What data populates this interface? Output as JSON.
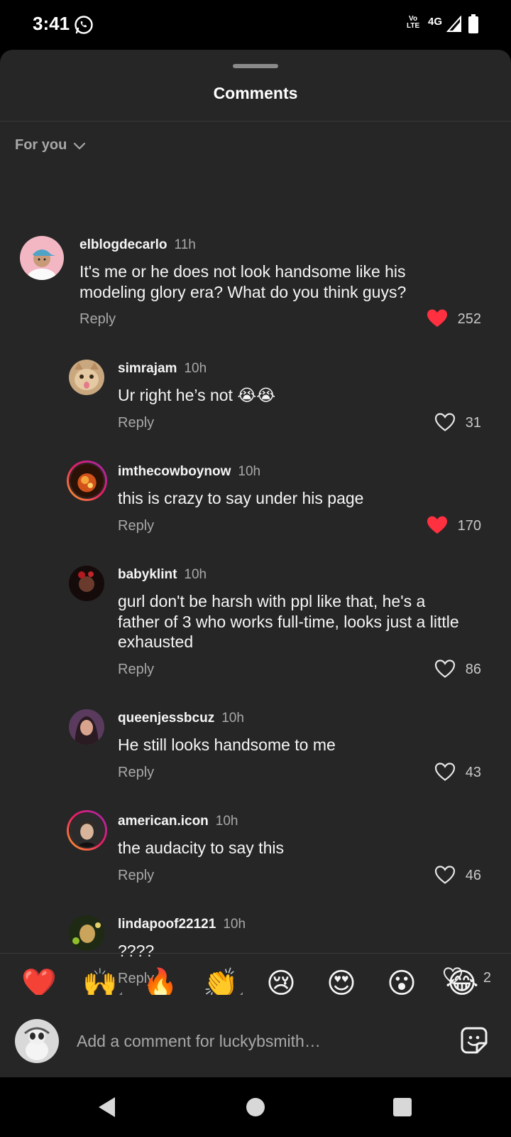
{
  "status_bar": {
    "time": "3:41",
    "network": "4G",
    "volte_line1": "Vo",
    "volte_line2": "LTE"
  },
  "sheet": {
    "title": "Comments",
    "sort_label": "For you"
  },
  "comments": [
    {
      "username": "elblogdecarlo",
      "time": "11h",
      "text": "It's me or he does not look handsome like his modeling glory era? What do you think guys?",
      "reply": "Reply",
      "likes": "252",
      "liked": true,
      "avatar_icon": "bitmoji-avatar"
    },
    {
      "username": "simrajam",
      "time": "10h",
      "text": "Ur right he’s not 😭😭",
      "reply": "Reply",
      "likes": "31",
      "liked": false,
      "avatar_icon": "cat-avatar"
    },
    {
      "username": "imthecowboynow",
      "time": "10h",
      "text": "this is  crazy to say under his page",
      "reply": "Reply",
      "likes": "170",
      "liked": true,
      "avatar_icon": "photo-avatar"
    },
    {
      "username": "babyklint",
      "time": "10h",
      "text": "gurl don't be harsh with ppl like that, he's a father of 3 who works full-time, looks just a little exhausted",
      "reply": "Reply",
      "likes": "86",
      "liked": false,
      "avatar_icon": "photo-avatar"
    },
    {
      "username": "queenjessbcuz",
      "time": "10h",
      "text": "He still looks handsome to me",
      "reply": "Reply",
      "likes": "43",
      "liked": false,
      "avatar_icon": "photo-avatar"
    },
    {
      "username": "american.icon",
      "time": "10h",
      "text": "the audacity to say this",
      "reply": "Reply",
      "likes": "46",
      "liked": false,
      "avatar_icon": "photo-avatar"
    },
    {
      "username": "lindapoof22121",
      "time": "10h",
      "text": "????",
      "reply": "Reply",
      "likes": "2",
      "liked": false,
      "avatar_icon": "photo-avatar"
    }
  ],
  "emoji_bar": [
    "❤️",
    "🙌",
    "🔥",
    "👏",
    "😢",
    "😍",
    "😮",
    "😂"
  ],
  "input": {
    "placeholder": "Add a comment for luckybsmith…"
  },
  "colors": {
    "sheet_bg": "#262626",
    "like_red": "#ff3040",
    "muted_text": "#a8a8a8"
  }
}
